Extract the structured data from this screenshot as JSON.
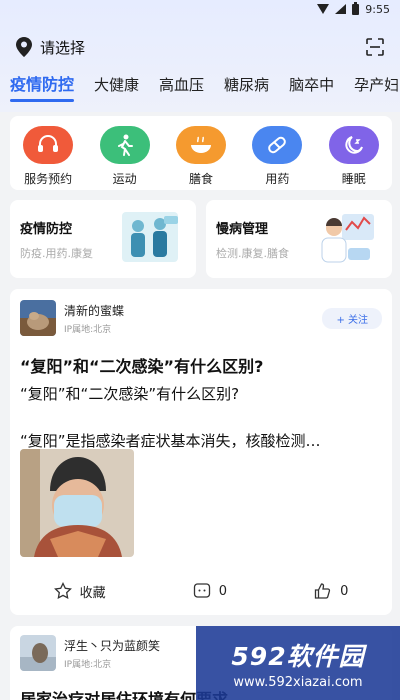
{
  "status_bar": {
    "time": "9:55"
  },
  "location": {
    "label": "请选择",
    "pin_icon": "location-pin-icon",
    "scan_icon": "scan-icon"
  },
  "tabs": [
    {
      "label": "疫情防控",
      "active": true
    },
    {
      "label": "大健康",
      "active": false
    },
    {
      "label": "高血压",
      "active": false
    },
    {
      "label": "糖尿病",
      "active": false
    },
    {
      "label": "脑卒中",
      "active": false
    },
    {
      "label": "孕产妇",
      "active": false
    }
  ],
  "services": [
    {
      "label": "服务预约",
      "icon": "headset-icon",
      "color": "#f05a3a"
    },
    {
      "label": "运动",
      "icon": "walking-icon",
      "color": "#3cbf7a"
    },
    {
      "label": "膳食",
      "icon": "bowl-icon",
      "color": "#f59a2f"
    },
    {
      "label": "用药",
      "icon": "pill-icon",
      "color": "#4a86f0"
    },
    {
      "label": "睡眠",
      "icon": "moon-icon",
      "color": "#8064e8"
    }
  ],
  "promos": [
    {
      "title": "疫情防控",
      "subtitle": "防疫.用药.康复"
    },
    {
      "title": "慢病管理",
      "subtitle": "检测.康复.膳食"
    }
  ],
  "post": {
    "author": "清新的蜜蝶",
    "ip": "IP属地:北京",
    "follow_label": "+ 关注",
    "title": "“复阳”和“二次感染”有什么区别?",
    "subtitle": "“复阳”和“二次感染”有什么区别?",
    "summary": "“复阳”是指感染者症状基本消失，核酸检测…",
    "actions": {
      "favorite_label": "收藏",
      "comment_count": "0",
      "like_count": "0"
    }
  },
  "post2": {
    "author": "浮生丶只为蓝颜笑",
    "ip": "IP属地:北京",
    "title": "居家治疗对居住环境有何要求"
  },
  "watermark": {
    "brand": "592软件园",
    "url": "www.592xiazai.com"
  }
}
